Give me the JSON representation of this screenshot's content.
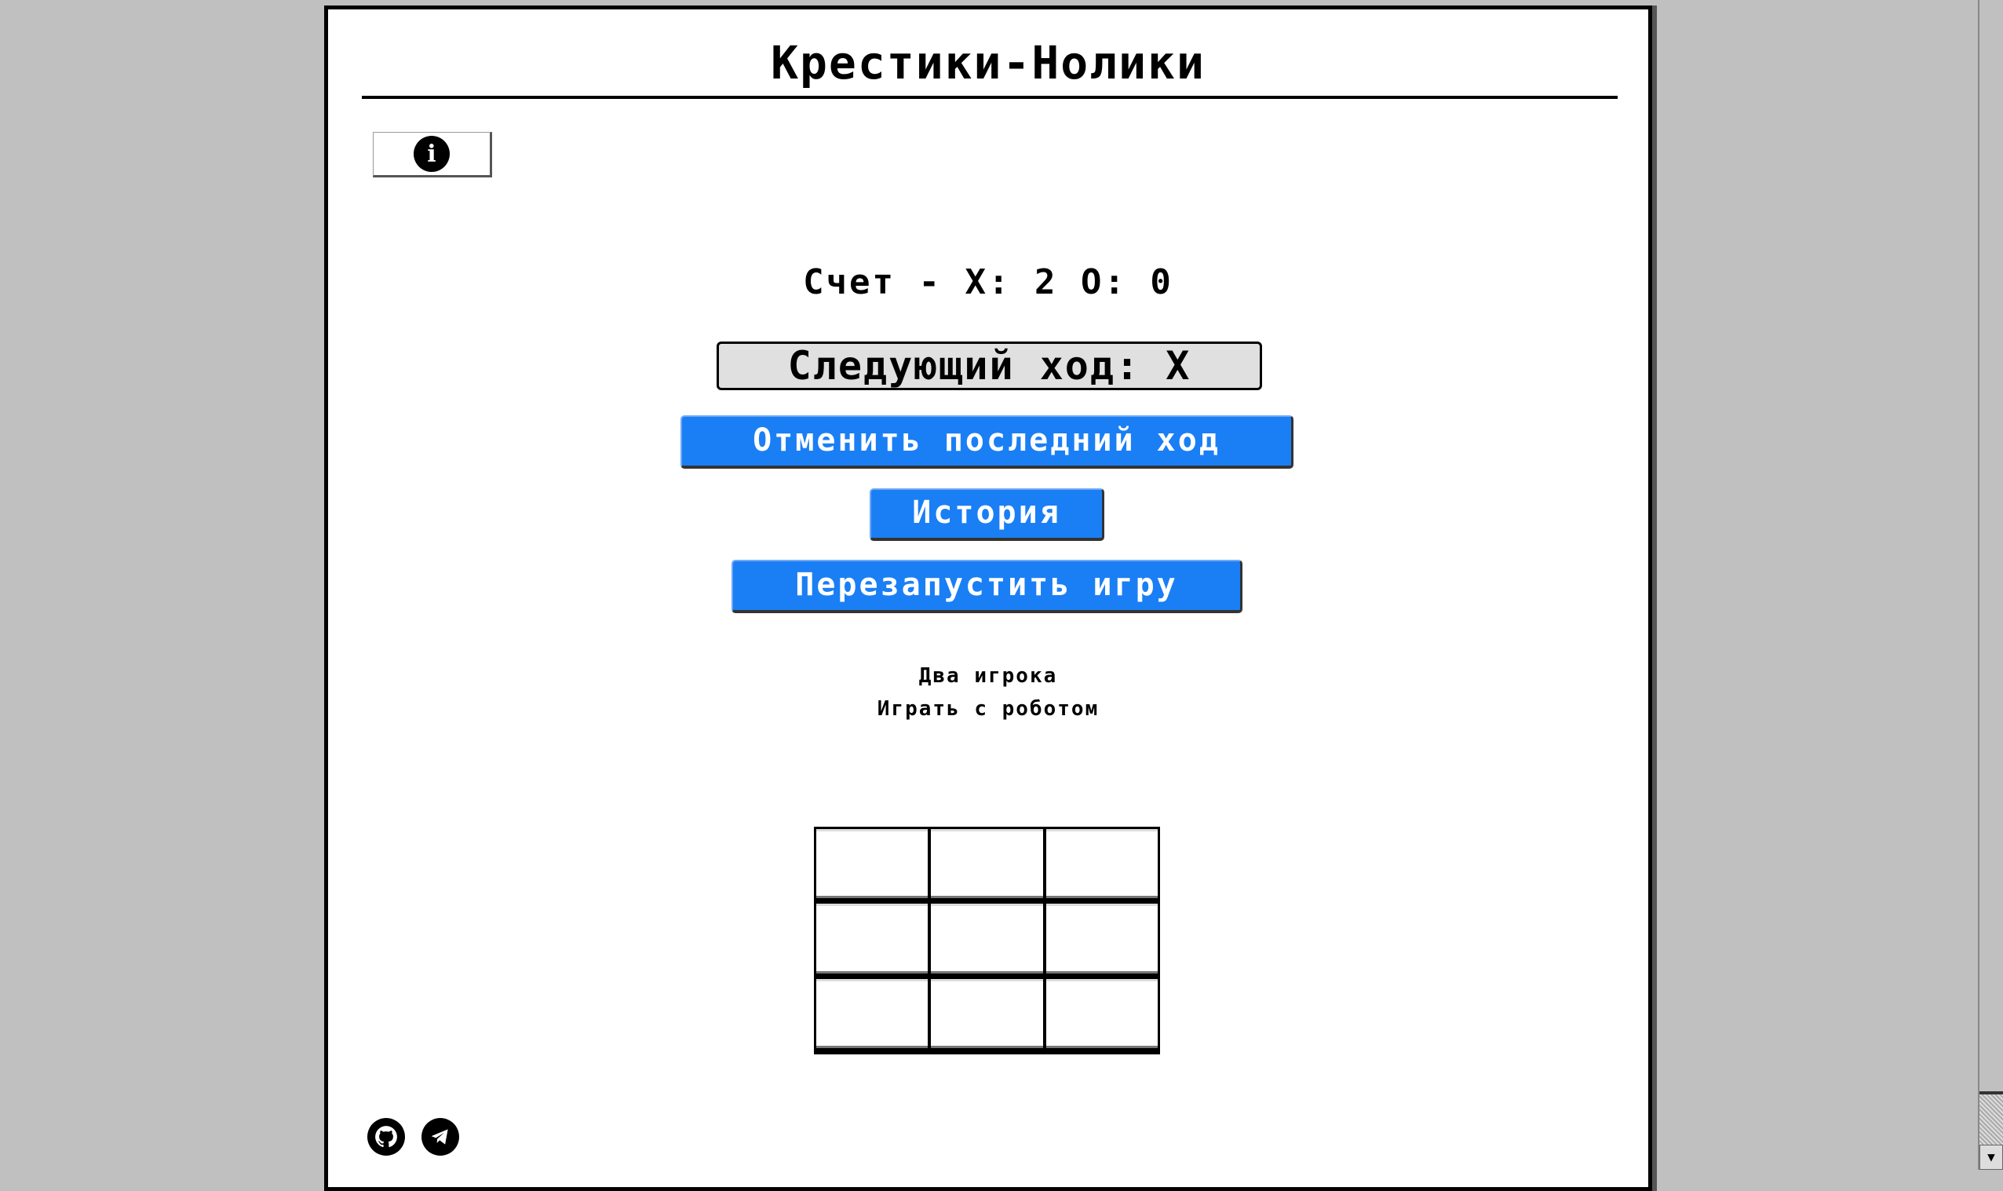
{
  "title": "Крестики-Нолики",
  "info_button": {
    "icon": "info-icon",
    "glyph": "i"
  },
  "score": "Счет - X: 2 O: 0",
  "next_turn": "Следующий ход: X",
  "buttons": {
    "undo": "Отменить последний ход",
    "history": "История",
    "restart": "Перезапустить игру"
  },
  "modes": [
    "Два игрока",
    "Играть с роботом"
  ],
  "board": [
    "",
    "",
    "",
    "",
    "",
    "",
    "",
    "",
    ""
  ],
  "social": [
    {
      "icon": "github-icon"
    },
    {
      "icon": "telegram-icon"
    }
  ],
  "scrollbar": {
    "up": "▲",
    "down": "▼"
  },
  "colors": {
    "accent": "#1a7ff5",
    "background": "#c0c0c0",
    "next_turn_bg": "#e0e0e0"
  }
}
